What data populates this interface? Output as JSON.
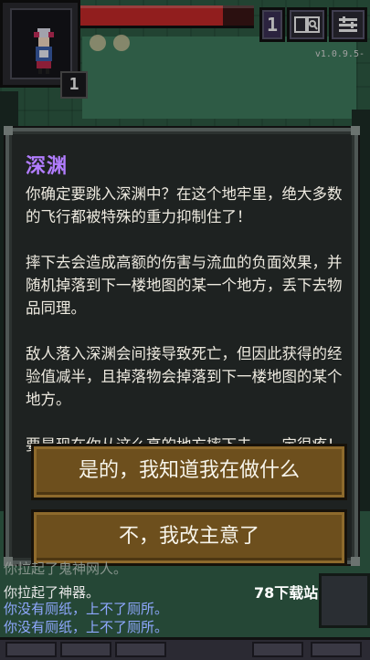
{
  "hud": {
    "depth": "1",
    "hero_level": "1",
    "version": "v1.0.9.5-",
    "hp_fraction": 0.82,
    "colors": {
      "hp": "#c22828",
      "accent_title": "#b27dff",
      "button": "#6d4f1d"
    }
  },
  "dialog": {
    "title": "深渊",
    "body": "你确定要跳入深渊中？在这个地牢里，绝大多数的飞行都被特殊的重力抑制住了！\n\n摔下去会造成高额的伤害与流血的负面效果，并随机掉落到下一楼地图的某一个地方，丢下去物品同理。\n\n敌人落入深渊会间接导致死亡，但因此获得的经验值减半，且掉落物会掉落到下一楼地图的某个地方。\n\n要是现在你从这么高的地方摔下去，一定很疼！",
    "confirm_label": "是的，我知道我在做什么",
    "cancel_label": "不，我改主意了"
  },
  "log": {
    "lines": [
      "你拉起了鬼神网人。",
      "你拉起了神器。",
      "你没有厕纸，上不了厕所。",
      "你没有厕纸，上不了厕所。"
    ]
  },
  "watermark": "78下载站",
  "icons": {
    "journal": "journal-icon",
    "menu": "menu-icon",
    "hero": "hero-sprite"
  }
}
